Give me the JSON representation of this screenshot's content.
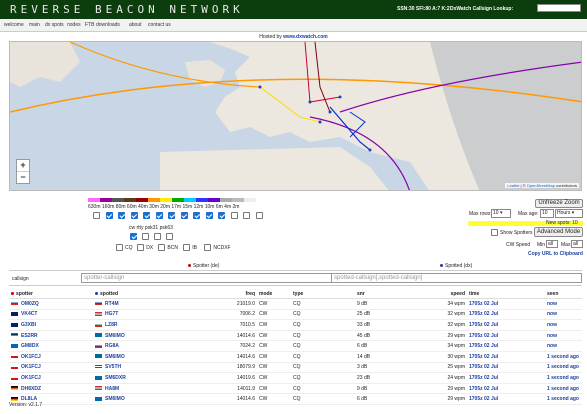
{
  "header": {
    "logo": "REVERSE BEACON NETWORK",
    "ssn": "SSN:30 SFI:80 A:7 K:2",
    "dx_lookup_label": "DxWatch Callsign Lookup:"
  },
  "nav": [
    "welcome",
    "main",
    "dx spots",
    "nodes",
    "FTB",
    "downloads",
    "about",
    "contact us"
  ],
  "hosted": {
    "prefix": "Hosted by",
    "link": "www.dxwatch.com"
  },
  "map": {
    "zoom_in": "+",
    "zoom_out": "−",
    "attribution_leaflet": "Leaflet",
    "attribution_sep": "| ©",
    "attribution_osm": "OpenStreetMap",
    "attribution_suffix": "contributors"
  },
  "bands": {
    "colors": [
      "#ff66ff",
      "#990099",
      "#555555",
      "#5a3b1c",
      "#990000",
      "#ff9900",
      "#ffee00",
      "#00aa00",
      "#00ccff",
      "#3333ff",
      "#6600cc",
      "#aaaaaa",
      "#bbbbbb",
      "#eeeeee"
    ],
    "labels": "630m 160m 80m 60m 40m 30m 20m 17m 15m 12m 10m 6m 4m 2m",
    "checked": [
      false,
      true,
      true,
      true,
      true,
      true,
      true,
      true,
      true,
      true,
      true,
      false,
      false,
      false
    ]
  },
  "modes": {
    "labels_text": "cw   rtty psk31 psk63",
    "checked": [
      true,
      false,
      false,
      false
    ]
  },
  "types": [
    "CQ",
    "DX",
    "BCN",
    "IB",
    "NCDXF"
  ],
  "controls": {
    "unfreeze": "Unfreeze Zoom",
    "max_rows_label": "Max rows:",
    "max_rows_value": "10",
    "max_age_label": "Max age:",
    "max_age_value": "10",
    "max_age_unit": "Hours",
    "new_spots": "New spots: 10",
    "show_spotters": "Show Spotters",
    "advanced_mode": "Advanced Mode",
    "cw_speed": "CW Speed",
    "min_label": "Min",
    "min_value": "all",
    "max_label": "Max",
    "max_value": "all",
    "copy_url": "Copy URL to Clipboard"
  },
  "legend": {
    "spotter": "Spotter (de)",
    "spotted": "Spotted (dx)",
    "spotter_color": "#d00000",
    "spotted_color": "#1a3fa0"
  },
  "filter": {
    "label": "callsign",
    "spotter_placeholder": "spotter-callsign",
    "spotted_placeholder": "spotted-callsign[,spotted-callsign]"
  },
  "table": {
    "headers": [
      "spotter",
      "spotted",
      "freq",
      "mode",
      "type",
      "snr",
      "speed",
      "time",
      "seen"
    ],
    "rows": [
      {
        "spotter": "OM0ZQ",
        "sflag": "sk",
        "spotted": "RT4M",
        "dflag": "ru",
        "freq": "21019.0",
        "mode": "CW",
        "type": "CQ",
        "snr": "9 dB",
        "speed": "34 wpm",
        "time": "1705z 02 Jul",
        "seen": "now"
      },
      {
        "spotter": "VK4CT",
        "sflag": "au",
        "spotted": "HG7T",
        "dflag": "hu",
        "freq": "7006.2",
        "mode": "CW",
        "type": "CQ",
        "snr": "25 dB",
        "speed": "32 wpm",
        "time": "1705z 02 Jul",
        "seen": "now"
      },
      {
        "spotter": "G3XBI",
        "sflag": "gb",
        "spotted": "LZ8R",
        "dflag": "bg",
        "freq": "7010.5",
        "mode": "CW",
        "type": "CQ",
        "snr": "33 dB",
        "speed": "32 wpm",
        "time": "1705z 02 Jul",
        "seen": "now"
      },
      {
        "spotter": "ES2RR",
        "sflag": "ee",
        "spotted": "SM6IMO",
        "dflag": "se",
        "freq": "14014.6",
        "mode": "CW",
        "type": "CQ",
        "snr": "45 dB",
        "speed": "29 wpm",
        "time": "1705z 02 Jul",
        "seen": "now"
      },
      {
        "spotter": "GM8DX",
        "sflag": "sc",
        "spotted": "RG8A",
        "dflag": "ru",
        "freq": "7024.2",
        "mode": "CW",
        "type": "CQ",
        "snr": "6 dB",
        "speed": "34 wpm",
        "time": "1705z 02 Jul",
        "seen": "now"
      },
      {
        "spotter": "OK1FCJ",
        "sflag": "cz",
        "spotted": "SM6IMO",
        "dflag": "se",
        "freq": "14014.6",
        "mode": "CW",
        "type": "CQ",
        "snr": "14 dB",
        "speed": "30 wpm",
        "time": "1705z 02 Jul",
        "seen": "1 second ago"
      },
      {
        "spotter": "OK1FCJ",
        "sflag": "cz",
        "spotted": "SV5TH",
        "dflag": "gr",
        "freq": "18079.9",
        "mode": "CW",
        "type": "CQ",
        "snr": "3 dB",
        "speed": "25 wpm",
        "time": "1705z 02 Jul",
        "seen": "1 second ago"
      },
      {
        "spotter": "OK1FCJ",
        "sflag": "cz",
        "spotted": "SM6DXR",
        "dflag": "se",
        "freq": "14019.6",
        "mode": "CW",
        "type": "CQ",
        "snr": "23 dB",
        "speed": "24 wpm",
        "time": "1705z 02 Jul",
        "seen": "1 second ago"
      },
      {
        "spotter": "DH8XDZ",
        "sflag": "de",
        "spotted": "HA8M",
        "dflag": "hu",
        "freq": "14011.9",
        "mode": "CW",
        "type": "CQ",
        "snr": "9 dB",
        "speed": "29 wpm",
        "time": "1705z 02 Jul",
        "seen": "1 second ago"
      },
      {
        "spotter": "DL8LA",
        "sflag": "de",
        "spotted": "SM6IMO",
        "dflag": "se",
        "freq": "14014.6",
        "mode": "CW",
        "type": "CQ",
        "snr": "6 dB",
        "speed": "29 wpm",
        "time": "1705z 02 Jul",
        "seen": "1 second ago"
      }
    ]
  },
  "version": "Version: v2.1.7"
}
